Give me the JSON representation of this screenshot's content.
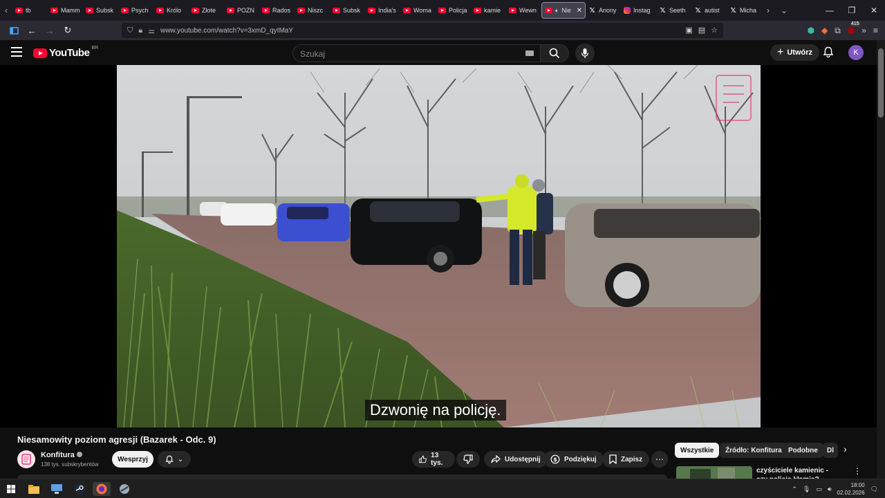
{
  "browser": {
    "tabs": [
      {
        "label": "tb",
        "icon": "youtube-icon"
      },
      {
        "label": "Mamm",
        "icon": "youtube-icon"
      },
      {
        "label": "Subsk",
        "icon": "youtube-icon"
      },
      {
        "label": "Psych",
        "icon": "youtube-icon"
      },
      {
        "label": "Królo",
        "icon": "youtube-icon"
      },
      {
        "label": "Złote",
        "icon": "youtube-icon"
      },
      {
        "label": "POZN",
        "icon": "youtube-icon"
      },
      {
        "label": "Rados",
        "icon": "youtube-icon"
      },
      {
        "label": "Niszc",
        "icon": "youtube-icon"
      },
      {
        "label": "Subsk",
        "icon": "youtube-icon"
      },
      {
        "label": "India's",
        "icon": "youtube-icon"
      },
      {
        "label": "Woma",
        "icon": "youtube-icon"
      },
      {
        "label": "Policja",
        "icon": "youtube-icon"
      },
      {
        "label": "kamie",
        "icon": "youtube-icon"
      },
      {
        "label": "Wewn",
        "icon": "youtube-icon"
      },
      {
        "label": "Nie",
        "icon": "youtube-icon",
        "active": true
      },
      {
        "label": "Anony",
        "icon": "x-icon"
      },
      {
        "label": "Instag",
        "icon": "instagram-icon"
      },
      {
        "label": "Seeth",
        "icon": "x-icon"
      },
      {
        "label": "autist",
        "icon": "x-icon"
      },
      {
        "label": "Micha",
        "icon": "x-icon"
      }
    ],
    "url": "www.youtube.com/watch?v=3xmD_qyIMaY",
    "extension_badge": "415"
  },
  "youtube": {
    "logo_text": "YouTube",
    "region": "BR",
    "search_placeholder": "Szukaj",
    "create_label": "Utwórz",
    "avatar_letter": "K"
  },
  "video": {
    "subtitle": "Dzwonię na policję.",
    "title": "Niesamowity poziom agresji (Bazarek - Odc. 9)",
    "channel": "Konfitura",
    "subscribers": "138 tys. subskrybentów",
    "support_label": "Wesprzyj",
    "likes": "13 tys.",
    "share_label": "Udostępnij",
    "thanks_label": "Podziękuj",
    "save_label": "Zapisz"
  },
  "chips": [
    "Wszystkie",
    "Źródło: Konfitura",
    "Podobne",
    "Dl"
  ],
  "recommendation": {
    "title": "czyściciele kamienic - czy policja kłamie?"
  },
  "taskbar": {
    "time": "18:00",
    "date": "02.02.2026"
  },
  "colors": {
    "youtube_red": "#ff0033",
    "page_bg": "#0f0f0f",
    "avatar_bg": "#7e57c2"
  }
}
